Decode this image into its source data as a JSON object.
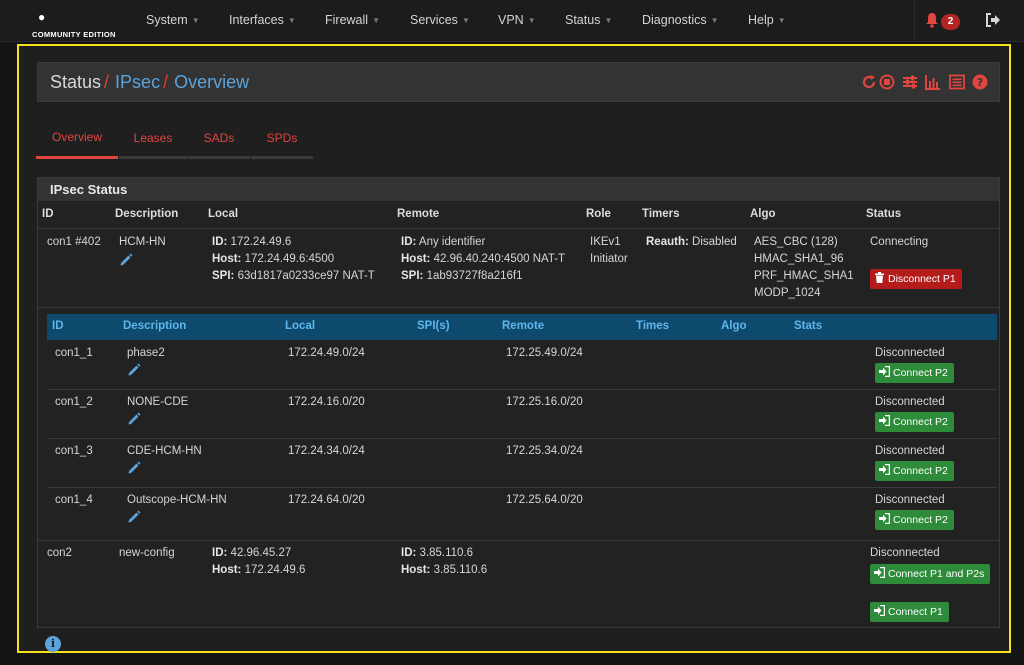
{
  "nav": {
    "logo_edition": "COMMUNITY EDITION",
    "items": [
      "System",
      "Interfaces",
      "Firewall",
      "Services",
      "VPN",
      "Status",
      "Diagnostics",
      "Help"
    ],
    "notifications_count": "2"
  },
  "header": {
    "crumbs": [
      "Status",
      "IPsec",
      "Overview"
    ]
  },
  "tabs": [
    "Overview",
    "Leases",
    "SADs",
    "SPDs"
  ],
  "active_tab": "Overview",
  "panel": {
    "title": "IPsec Status",
    "columns": [
      "ID",
      "Description",
      "Local",
      "Remote",
      "Role",
      "Timers",
      "Algo",
      "Status"
    ],
    "con1": {
      "id": "con1 #402",
      "description": "HCM-HN",
      "local_id_label": "ID:",
      "local_id": "172.24.49.6",
      "local_host_label": "Host:",
      "local_host": "172.24.49.6:4500",
      "local_spi_label": "SPI:",
      "local_spi": "63d1817a0233ce97 NAT-T",
      "remote_id_label": "ID:",
      "remote_id": "Any identifier",
      "remote_host_label": "Host:",
      "remote_host": "42.96.40.240:4500 NAT-T",
      "remote_spi_label": "SPI:",
      "remote_spi": "1ab93727f8a216f1",
      "role_1": "IKEv1",
      "role_2": "Initiator",
      "timers_label": "Reauth:",
      "timers": "Disabled",
      "algo": [
        "AES_CBC (128)",
        "HMAC_SHA1_96",
        "PRF_HMAC_SHA1",
        "MODP_1024"
      ],
      "status": "Connecting",
      "button": "Disconnect P1"
    },
    "child_columns": [
      "ID",
      "Description",
      "Local",
      "SPI(s)",
      "Remote",
      "Times",
      "Algo",
      "Stats"
    ],
    "children": [
      {
        "id": "con1_1",
        "description": "phase2",
        "local": "172.24.49.0/24",
        "remote": "172.25.49.0/24",
        "status": "Disconnected",
        "button": "Connect P2"
      },
      {
        "id": "con1_2",
        "description": "NONE-CDE",
        "local": "172.24.16.0/20",
        "remote": "172.25.16.0/20",
        "status": "Disconnected",
        "button": "Connect P2"
      },
      {
        "id": "con1_3",
        "description": "CDE-HCM-HN",
        "local": "172.24.34.0/24",
        "remote": "172.25.34.0/24",
        "status": "Disconnected",
        "button": "Connect P2"
      },
      {
        "id": "con1_4",
        "description": "Outscope-HCM-HN",
        "local": "172.24.64.0/20",
        "remote": "172.25.64.0/20",
        "status": "Disconnected",
        "button": "Connect P2"
      }
    ],
    "con2": {
      "id": "con2",
      "description": "new-config",
      "local_id_label": "ID:",
      "local_id": "42.96.45.27",
      "local_host_label": "Host:",
      "local_host": "172.24.49.6",
      "remote_id_label": "ID:",
      "remote_id": "3.85.110.6",
      "remote_host_label": "Host:",
      "remote_host": "3.85.110.6",
      "status": "Disconnected",
      "button_1": "Connect P1 and P2s",
      "button_2": "Connect P1"
    }
  },
  "colors": {
    "accent_red": "#e0453f",
    "link_blue": "#5ba3db",
    "highlight_yellow": "#f5e11b",
    "button_green": "#2e8b3a",
    "button_red": "#b41c1c"
  }
}
